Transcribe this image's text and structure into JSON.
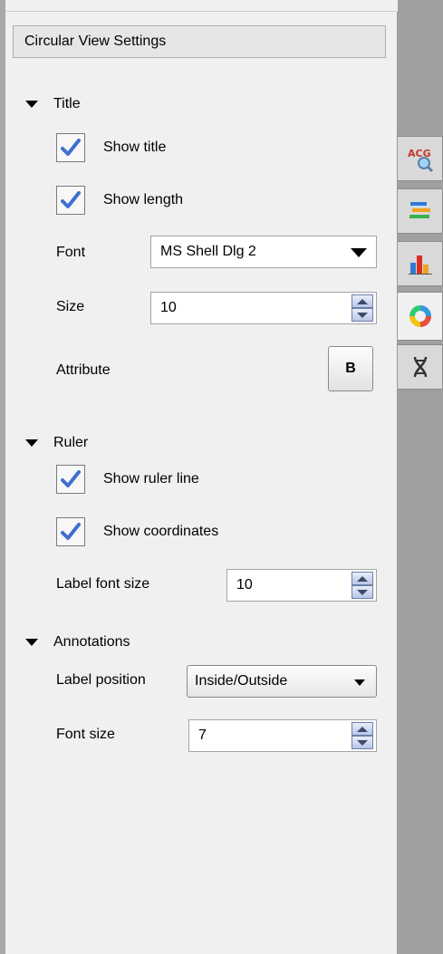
{
  "header": {
    "title": "Circular View Settings"
  },
  "title_section": {
    "heading": "Title",
    "show_title": {
      "label": "Show title",
      "checked": true
    },
    "show_length": {
      "label": "Show length",
      "checked": true
    },
    "font": {
      "label": "Font",
      "value": "MS Shell Dlg 2"
    },
    "size": {
      "label": "Size",
      "value": "10"
    },
    "attribute": {
      "label": "Attribute",
      "bold_button": "B"
    }
  },
  "ruler_section": {
    "heading": "Ruler",
    "show_ruler_line": {
      "label": "Show ruler line",
      "checked": true
    },
    "show_coordinates": {
      "label": "Show coordinates",
      "checked": true
    },
    "label_font_size": {
      "label": "Label font size",
      "value": "10"
    }
  },
  "annotations_section": {
    "heading": "Annotations",
    "label_position": {
      "label": "Label position",
      "value": "Inside/Outside"
    },
    "font_size": {
      "label": "Font size",
      "value": "7"
    }
  },
  "side_tabs": [
    {
      "icon": "sequence-search-icon",
      "text": "ACG",
      "active": false
    },
    {
      "icon": "layers-icon",
      "active": false
    },
    {
      "icon": "bar-chart-icon",
      "active": false
    },
    {
      "icon": "circular-view-icon",
      "active": true
    },
    {
      "icon": "dna-icon",
      "active": false
    }
  ],
  "colors": {
    "check": "#3f6fcf",
    "panel_bg": "#f0f0f0",
    "tab_bar": "#a0a0a0"
  }
}
